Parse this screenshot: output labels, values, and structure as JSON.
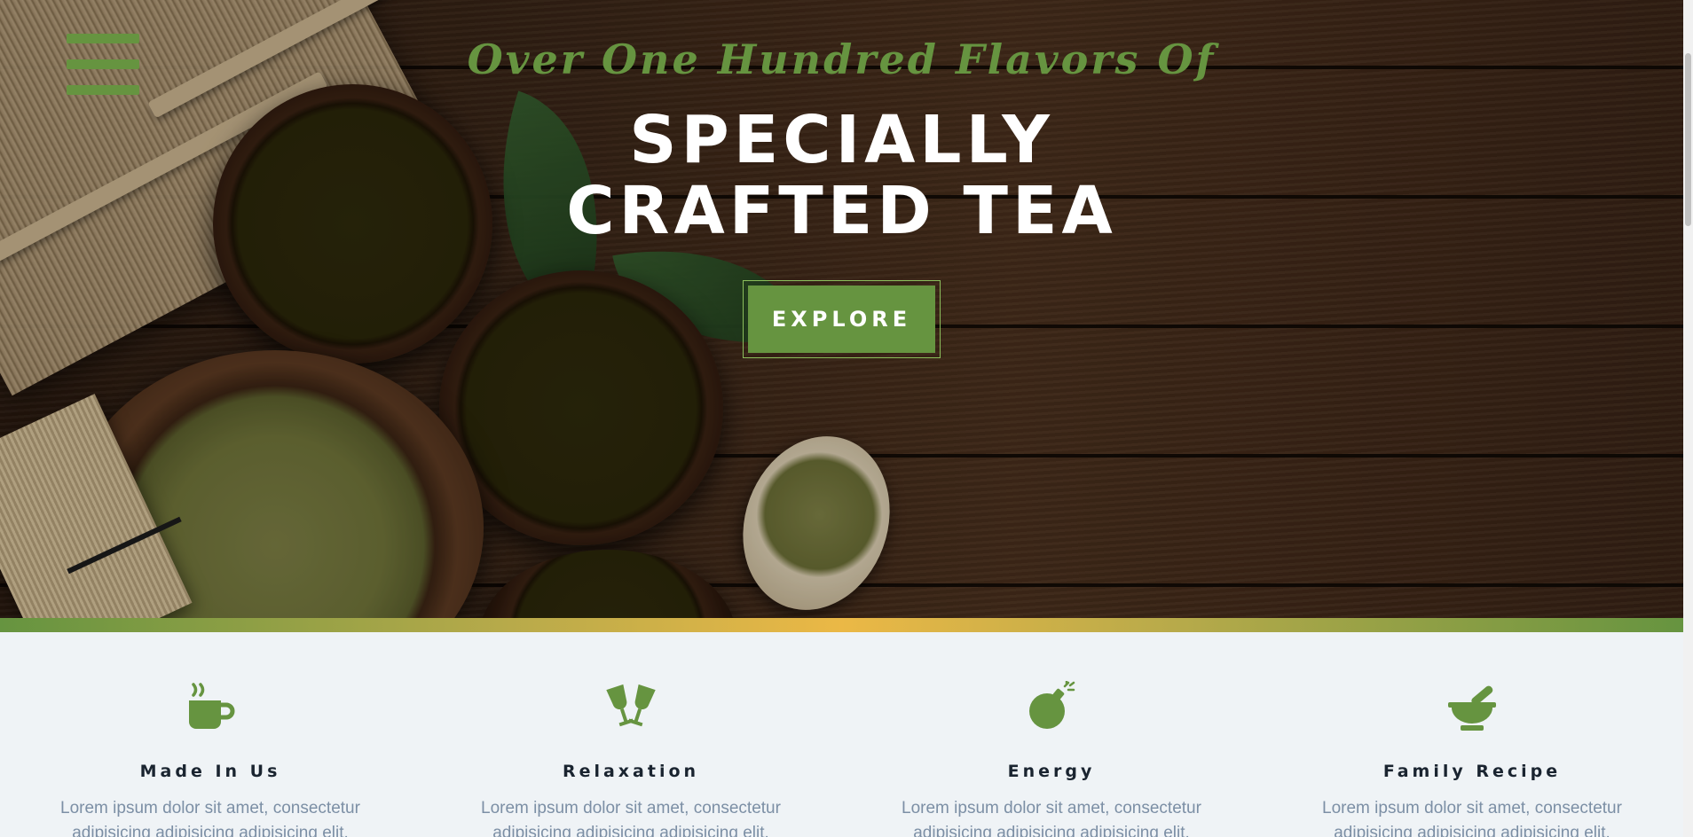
{
  "hero": {
    "kicker": "Over One Hundred Flavors Of",
    "headline_line1": "SPECIALLY",
    "headline_line2": "CRAFTED TEA",
    "cta_label": "EXPLORE"
  },
  "menu": {
    "icon": "hamburger-menu-icon"
  },
  "colors": {
    "accent": "#669440",
    "gold": "#ebb846",
    "heading": "#1a2430",
    "body_text": "#7c8fa5",
    "section_bg": "#eff3f6"
  },
  "features": [
    {
      "icon": "coffee-mug-icon",
      "title": "Made In Us",
      "text": "Lorem ipsum dolor sit amet, consectetur adipisicing adipisicing adipisicing elit."
    },
    {
      "icon": "cheers-glasses-icon",
      "title": "Relaxation",
      "text": "Lorem ipsum dolor sit amet, consectetur adipisicing adipisicing adipisicing elit."
    },
    {
      "icon": "bomb-icon",
      "title": "Energy",
      "text": "Lorem ipsum dolor sit amet, consectetur adipisicing adipisicing adipisicing elit."
    },
    {
      "icon": "mortar-pestle-icon",
      "title": "Family Recipe",
      "text": "Lorem ipsum dolor sit amet, consectetur adipisicing adipisicing adipisicing elit."
    }
  ]
}
